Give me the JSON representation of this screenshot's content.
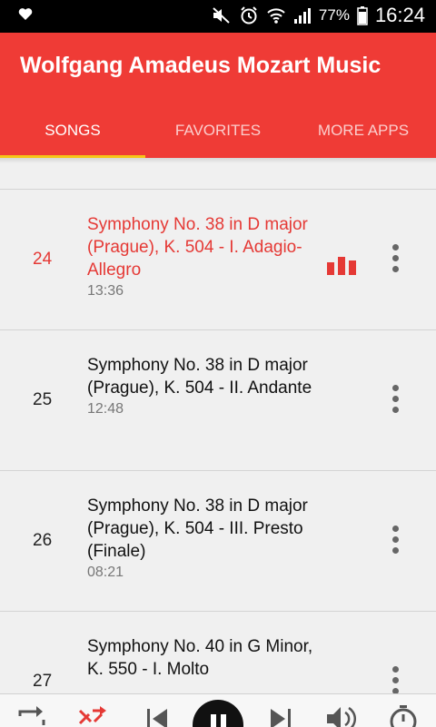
{
  "status_bar": {
    "battery": "77%",
    "time": "16:24",
    "icons": [
      "heart-icon",
      "mute-icon",
      "alarm-icon",
      "wifi-icon",
      "signal-icon",
      "battery-icon"
    ]
  },
  "app": {
    "title": "Wolfgang Amadeus Mozart Music",
    "accent_color": "#ef3b36",
    "tab_indicator_color": "#f5c518"
  },
  "tabs": [
    {
      "label": "SONGS",
      "active": true
    },
    {
      "label": "FAVORITES",
      "active": false
    },
    {
      "label": "MORE APPS",
      "active": false
    }
  ],
  "songs": [
    {
      "number": "24",
      "title": "Symphony No. 38 in D major (Prague), K. 504 - I. Adagio-Allegro",
      "duration": "13:36",
      "playing": true
    },
    {
      "number": "25",
      "title": "Symphony No. 38 in D major (Prague), K. 504 - II. Andante",
      "duration": "12:48",
      "playing": false
    },
    {
      "number": "26",
      "title": "Symphony No. 38 in D major (Prague), K. 504 - III. Presto (Finale)",
      "duration": "08:21",
      "playing": false
    },
    {
      "number": "27",
      "title": "Symphony No. 40 in G Minor, K. 550 - I. Molto",
      "duration": "",
      "playing": false
    }
  ],
  "player_controls": [
    "repeat-icon",
    "shuffle-icon",
    "previous-icon",
    "pause-icon",
    "next-icon",
    "volume-icon",
    "timer-icon"
  ]
}
